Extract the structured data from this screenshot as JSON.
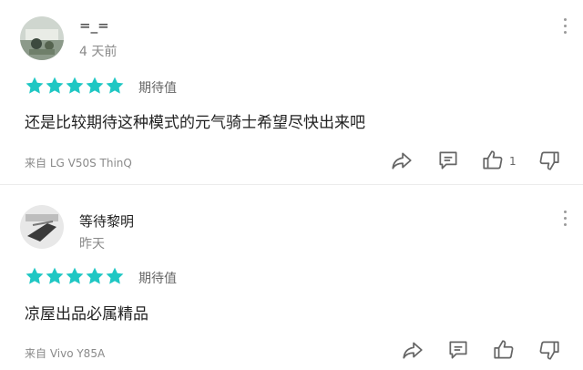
{
  "reviews": [
    {
      "username": "=_=",
      "time": "4 天前",
      "rating": 5,
      "rating_label": "期待值",
      "content": "还是比较期待这种模式的元气骑士希望尽快出来吧",
      "device": "来自 LG V50S ThinQ",
      "like_count": "1",
      "colors": {
        "star": "#1fc7c3"
      }
    },
    {
      "username": "等待黎明",
      "time": "昨天",
      "rating": 5,
      "rating_label": "期待值",
      "content": "凉屋出品必属精品",
      "device": "来自 Vivo Y85A",
      "like_count": "",
      "colors": {
        "star": "#1fc7c3"
      }
    }
  ],
  "icons": [
    "more-vertical-icon",
    "share-icon",
    "reply-icon",
    "thumbs-up-icon",
    "thumbs-down-icon",
    "star-icon"
  ]
}
